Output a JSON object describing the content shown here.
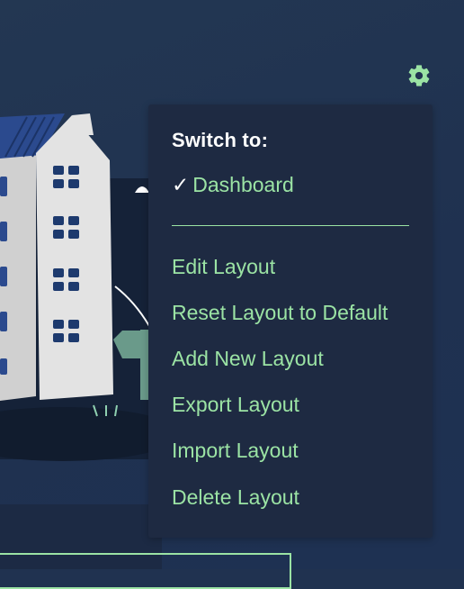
{
  "colors": {
    "background": "#203250",
    "menu_background": "#1e2a42",
    "accent_green": "#9be3a4",
    "heading_text": "#ffffff"
  },
  "icons": {
    "settings": "gear-icon",
    "selected": "checkmark-icon"
  },
  "menu": {
    "heading": "Switch to:",
    "current_check": "✓",
    "current_layout": "Dashboard",
    "items": [
      "Edit Layout",
      "Reset Layout to Default",
      "Add New Layout",
      "Export Layout",
      "Import Layout",
      "Delete Layout"
    ]
  }
}
